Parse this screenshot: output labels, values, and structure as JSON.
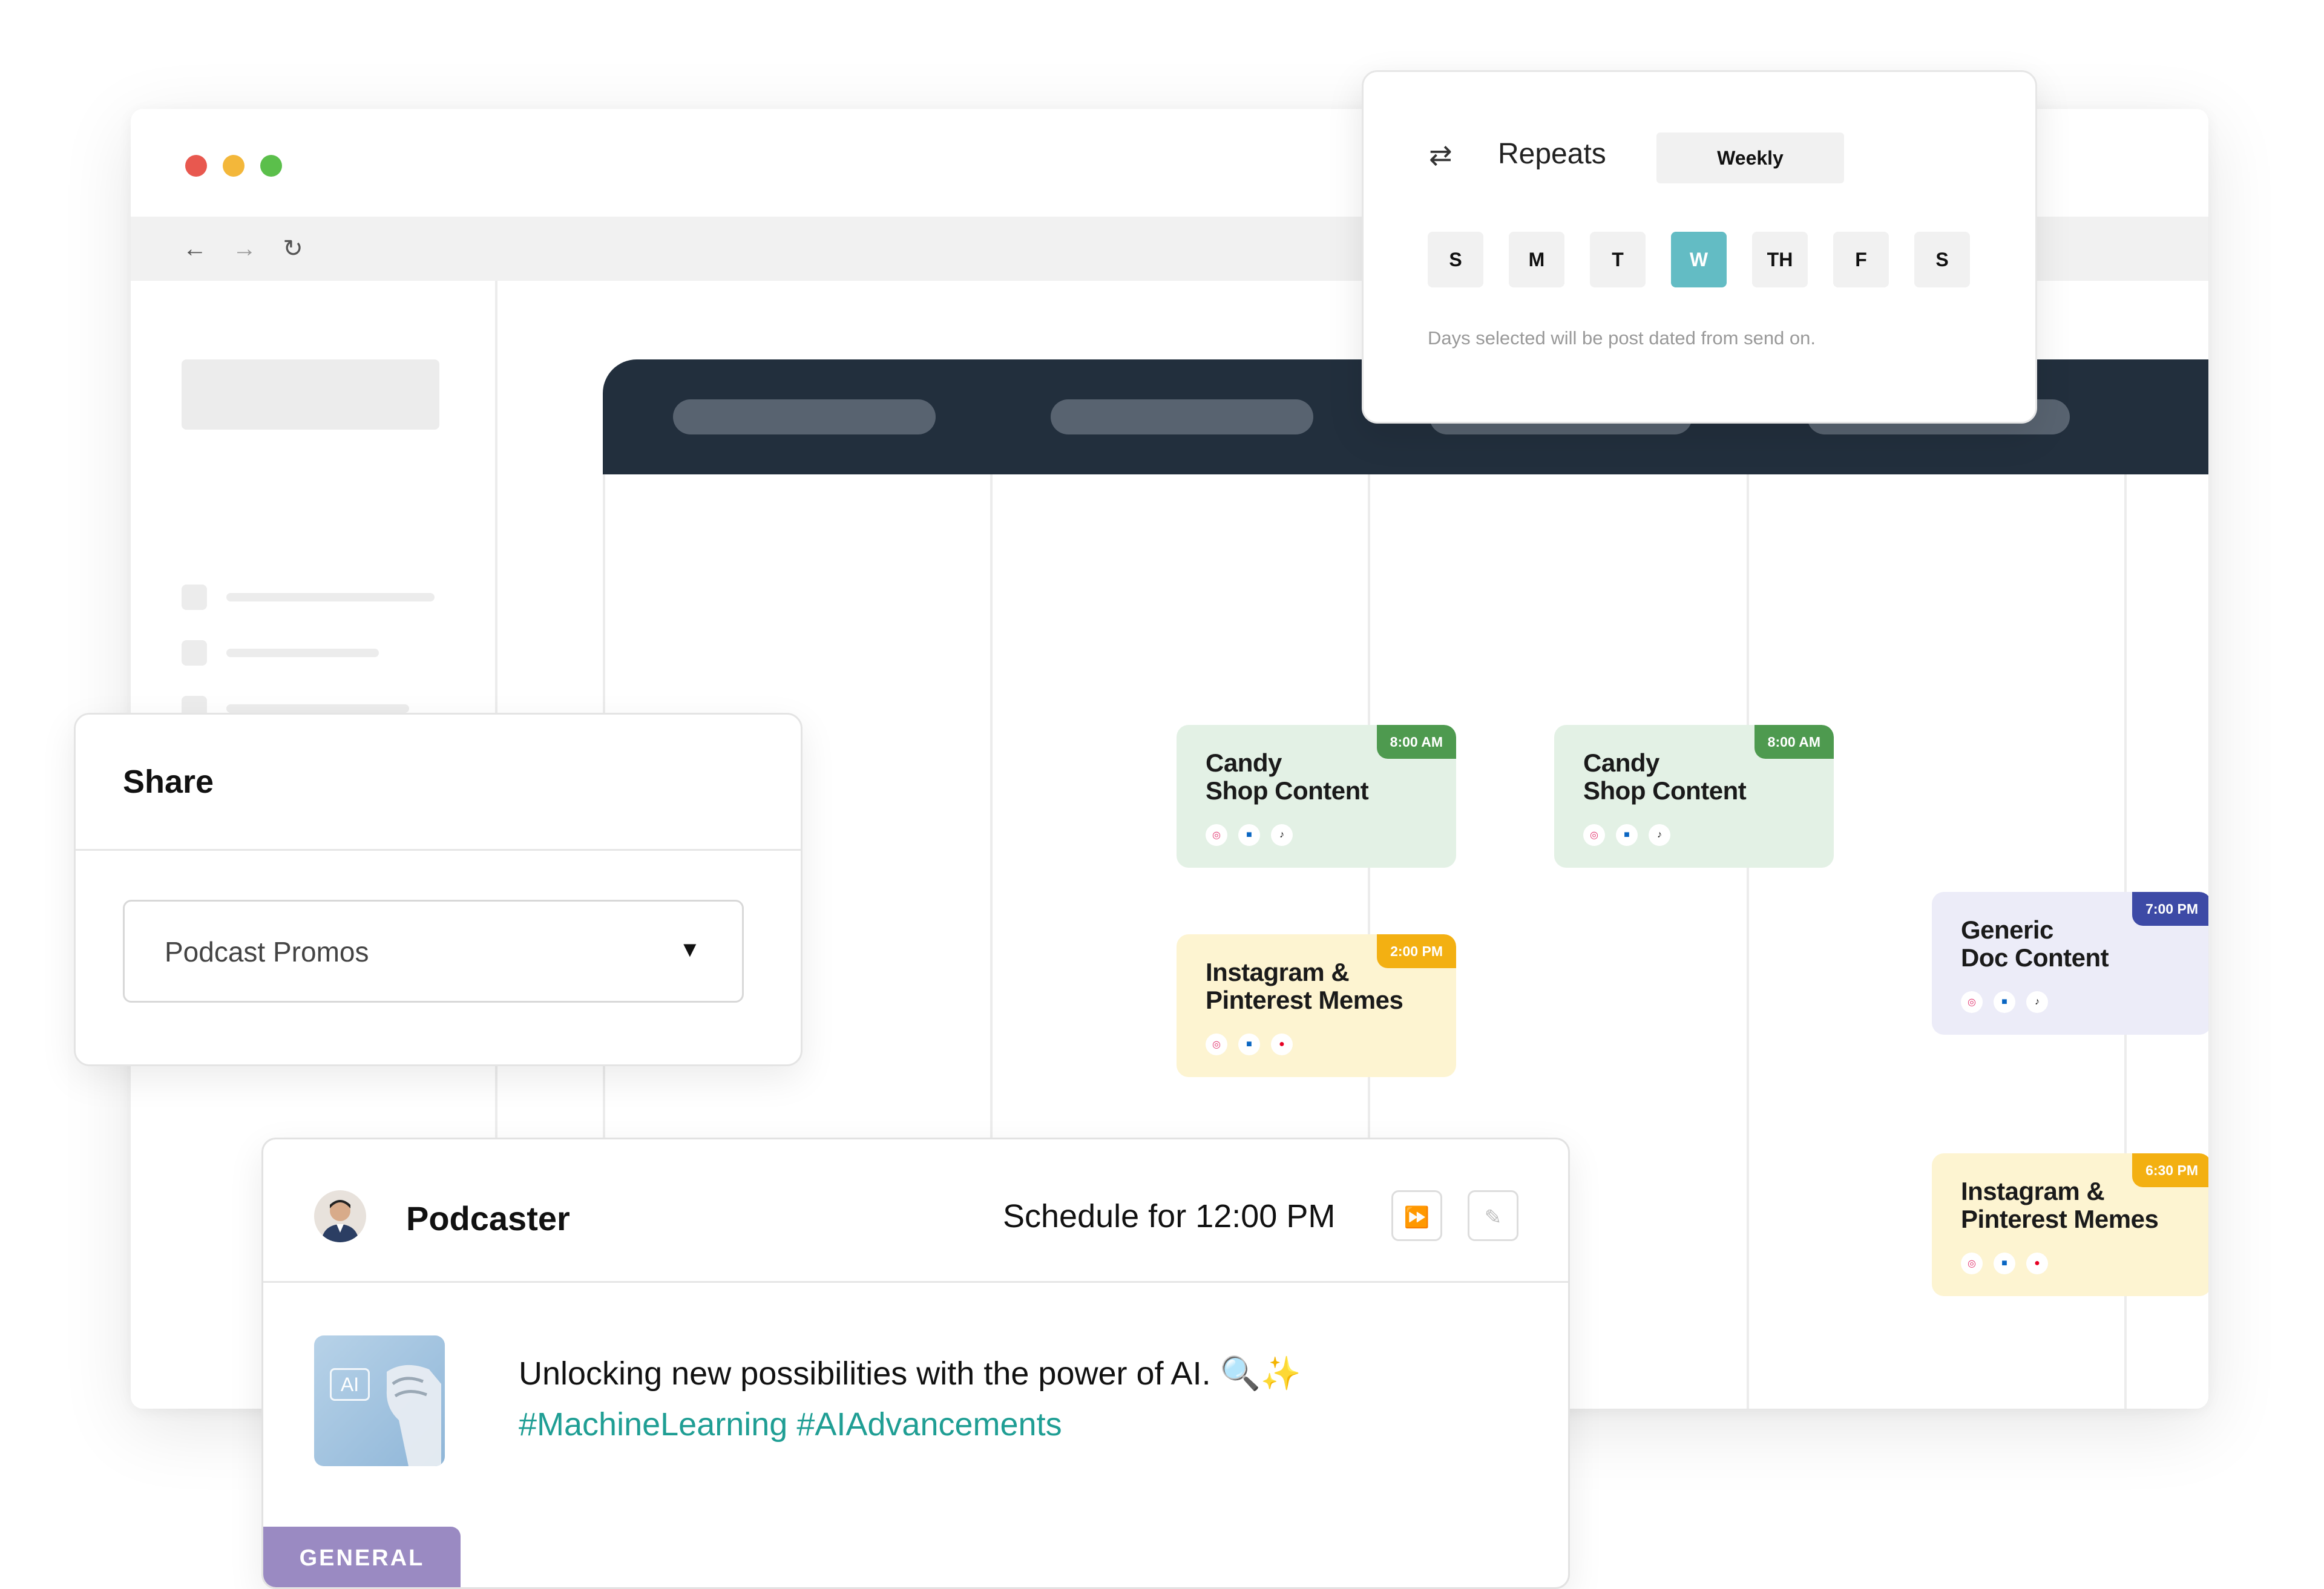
{
  "repeats": {
    "label": "Repeats",
    "frequency": "Weekly",
    "days": [
      "S",
      "M",
      "T",
      "W",
      "TH",
      "F",
      "S"
    ],
    "selected_day": "W",
    "hint": "Days selected will be post dated from send on."
  },
  "calendar": {
    "cards": [
      {
        "title_line1": "Candy",
        "title_line2": "Shop Content",
        "time": "8:00 AM"
      },
      {
        "title_line1": "Candy",
        "title_line2": "Shop Content",
        "time": "8:00 AM"
      },
      {
        "title_line1": "Instagram &",
        "title_line2": "Pinterest Memes",
        "time": "2:00 PM"
      },
      {
        "title_line1": "Generic",
        "title_line2": "Doc Content",
        "time": "7:00 PM"
      },
      {
        "title_line1": "Instagram &",
        "title_line2": "Pinterest Memes",
        "time": "6:30 PM"
      }
    ]
  },
  "share": {
    "title": "Share",
    "selected_option": "Podcast Promos"
  },
  "post": {
    "author": "Podcaster",
    "schedule": "Schedule for 12:00 PM",
    "text": "Unlocking new possibilities with the power of AI. 🔍✨",
    "hashtags": "#MachineLearning #AIAdvancements",
    "image_label": "AI",
    "tag": "GENERAL"
  },
  "colors": {
    "accent_teal": "#63bcc4",
    "hashtag": "#1f9e94",
    "header_dark": "#222f3d",
    "tag_purple": "#9a8ac2"
  }
}
